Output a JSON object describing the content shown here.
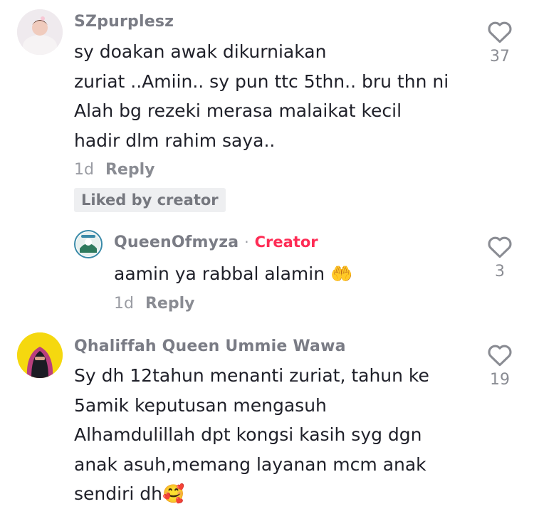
{
  "comments": [
    {
      "username": "SZpurplesz",
      "lines": [
        "sy doakan awak dikurniakan",
        "zuriat ..Amiin.. sy pun ttc 5thn.. bru thn ni",
        "Alah bg rezeki merasa malaikat kecil",
        "hadir dlm rahim saya.."
      ],
      "time": "1d",
      "reply_label": "Reply",
      "liked_badge": "Liked by creator",
      "likes": "37",
      "icons": {
        "avatar": "avatar-baby",
        "like": "heart-outline-icon"
      }
    },
    {
      "username": "QueenOfmyza",
      "separator": "·",
      "badge": "Creator",
      "text": "aamin ya rabbal alamin",
      "emoji": "🤲",
      "time": "1d",
      "reply_label": "Reply",
      "likes": "3",
      "icons": {
        "avatar": "avatar-circle-logo",
        "like": "heart-outline-icon"
      }
    },
    {
      "username": "Qhaliffah Queen Ummie Wawa",
      "lines": [
        "Sy dh 12tahun menanti zuriat, tahun ke",
        "5amik keputusan mengasuh",
        "Alhamdulillah dpt kongsi kasih syg dgn",
        "anak asuh,memang layanan mcm anak",
        "sendiri dh"
      ],
      "emoji": "🥰",
      "likes": "19",
      "icons": {
        "avatar": "avatar-hijab-yellow",
        "like": "heart-outline-icon"
      }
    }
  ],
  "colors": {
    "creator": "#fe2c55",
    "muted": "#9a9ca3",
    "text": "#1f2029"
  }
}
